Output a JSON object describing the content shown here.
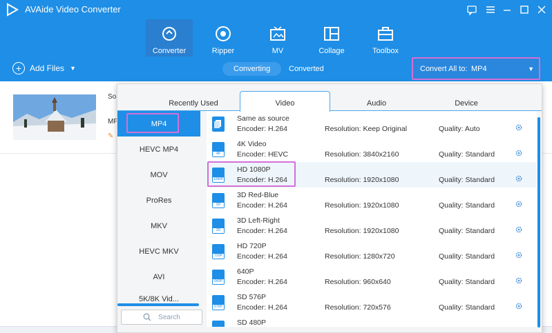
{
  "app": {
    "title": "AVAide Video Converter"
  },
  "nav": {
    "tabs": [
      {
        "label": "Converter",
        "icon": "converter-icon"
      },
      {
        "label": "Ripper",
        "icon": "ripper-icon"
      },
      {
        "label": "MV",
        "icon": "mv-icon"
      },
      {
        "label": "Collage",
        "icon": "collage-icon"
      },
      {
        "label": "Toolbox",
        "icon": "toolbox-icon"
      }
    ]
  },
  "toolbar": {
    "add_files": "Add Files",
    "seg_converting": "Converting",
    "seg_converted": "Converted",
    "convert_all_label": "Convert All to:",
    "convert_all_value": "MP4"
  },
  "file": {
    "name_partial": "So",
    "format_partial": "MP"
  },
  "popup": {
    "tabs": [
      "Recently Used",
      "Video",
      "Audio",
      "Device"
    ],
    "active_tab": "Video",
    "categories": [
      "MP4",
      "HEVC MP4",
      "MOV",
      "ProRes",
      "MKV",
      "HEVC MKV",
      "AVI",
      "5K/8K Vid..."
    ],
    "search_placeholder": "Search",
    "formats": [
      {
        "name": "Same as source",
        "encoder": "Encoder: H.264",
        "resolution": "Resolution: Keep Original",
        "quality": "Quality: Auto",
        "tag": ""
      },
      {
        "name": "4K Video",
        "encoder": "Encoder: HEVC",
        "resolution": "Resolution: 3840x2160",
        "quality": "Quality: Standard",
        "tag": "4K"
      },
      {
        "name": "HD 1080P",
        "encoder": "Encoder: H.264",
        "resolution": "Resolution: 1920x1080",
        "quality": "Quality: Standard",
        "tag": "1080P"
      },
      {
        "name": "3D Red-Blue",
        "encoder": "Encoder: H.264",
        "resolution": "Resolution: 1920x1080",
        "quality": "Quality: Standard",
        "tag": "3D"
      },
      {
        "name": "3D Left-Right",
        "encoder": "Encoder: H.264",
        "resolution": "Resolution: 1920x1080",
        "quality": "Quality: Standard",
        "tag": "3D"
      },
      {
        "name": "HD 720P",
        "encoder": "Encoder: H.264",
        "resolution": "Resolution: 1280x720",
        "quality": "Quality: Standard",
        "tag": "720P"
      },
      {
        "name": "640P",
        "encoder": "Encoder: H.264",
        "resolution": "Resolution: 960x640",
        "quality": "Quality: Standard",
        "tag": "640P"
      },
      {
        "name": "SD 576P",
        "encoder": "Encoder: H.264",
        "resolution": "Resolution: 720x576",
        "quality": "Quality: Standard",
        "tag": "576P"
      },
      {
        "name": "SD 480P",
        "encoder": "",
        "resolution": "",
        "quality": "",
        "tag": ""
      }
    ]
  },
  "colors": {
    "brand": "#1e8ee6",
    "highlight_box": "#d46fd7"
  }
}
